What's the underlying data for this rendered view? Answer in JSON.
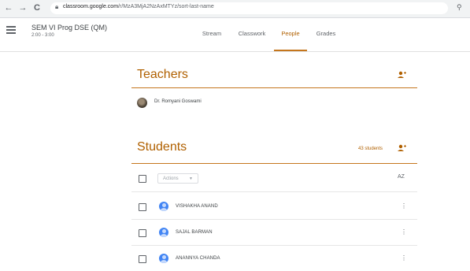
{
  "browser": {
    "url_host": "classroom.google.com",
    "url_path": "/r/MzA3MjA2NzAxMTYz/sort-last-name",
    "nav_back": "←",
    "nav_forward": "→",
    "nav_reload": "C"
  },
  "class": {
    "name": "SEM VI Prog DSE (QM)",
    "section": "2:00 - 3:00"
  },
  "tabs": [
    {
      "label": "Stream"
    },
    {
      "label": "Classwork"
    },
    {
      "label": "People"
    },
    {
      "label": "Grades"
    }
  ],
  "active_tab": "People",
  "teachers": {
    "title": "Teachers",
    "list": [
      {
        "name": "Dr. Romyani Goswami"
      }
    ]
  },
  "students": {
    "title": "Students",
    "count_label": "43 students",
    "actions_label": "Actions",
    "sort_label": "AZ",
    "list": [
      {
        "name": "VISHAKHA ANAND"
      },
      {
        "name": "SAJAL BARMAN"
      },
      {
        "name": "ANANNYA CHANDA"
      }
    ]
  },
  "colors": {
    "accent": "#b06000",
    "accent_rule": "#c5761d",
    "avatar_blue": "#4285f4"
  },
  "icons": {
    "menu": "hamburger-menu-icon",
    "add_person": "add-person-icon",
    "more": "more-vert-icon",
    "sort": "sort-az-icon"
  }
}
